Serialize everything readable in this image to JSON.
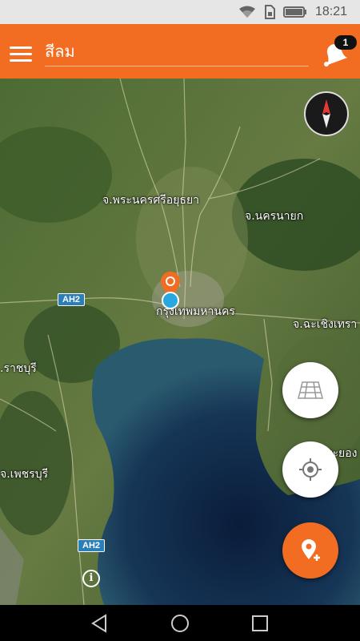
{
  "status_bar": {
    "time": "18:21"
  },
  "app_bar": {
    "search_value": "สีลม",
    "notification_count": "1",
    "menu_icon": "hamburger-icon",
    "notify_icon": "bell-icon"
  },
  "map": {
    "labels": {
      "ayutthaya": "จ.พระนครศรีอยุธยา",
      "nakhon_nayok": "จ.นครนายก",
      "bangkok": "กรุงเทพมหานคร",
      "chachoengsao": "จ.ฉะเชิงเทรา",
      "ratchaburi": ".ราชบุรี",
      "phetchaburi": "จ.เพชรบุรี",
      "chonburi": "ระยอง"
    },
    "routes": {
      "ah2_a": "AH2",
      "ah2_b": "AH2"
    },
    "info": "i"
  },
  "controls": {
    "compass_icon": "compass-icon",
    "layers_icon": "map-layers-icon",
    "locate_icon": "my-location-icon",
    "add_place_icon": "add-location-icon"
  },
  "colors": {
    "accent": "#f26c21",
    "user_location": "#29a8e0",
    "route_shield": "#2b7fb8"
  },
  "nav": {
    "back": "back-icon",
    "home": "home-icon",
    "recents": "recents-icon"
  }
}
